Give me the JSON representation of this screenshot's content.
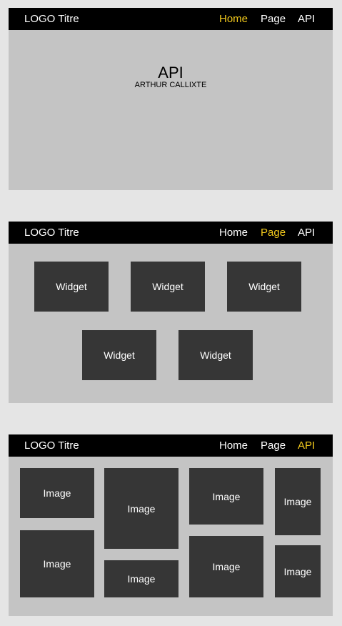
{
  "frames": [
    {
      "nav": {
        "logo": "LOGO Titre",
        "links": [
          "Home",
          "Page",
          "API"
        ],
        "active": "Home"
      },
      "hero": {
        "title": "API",
        "subtitle": "ARTHUR CALLIXTE"
      }
    },
    {
      "nav": {
        "logo": "LOGO Titre",
        "links": [
          "Home",
          "Page",
          "API"
        ],
        "active": "Page"
      },
      "widgets": [
        "Widget",
        "Widget",
        "Widget",
        "Widget",
        "Widget"
      ]
    },
    {
      "nav": {
        "logo": "LOGO Titre",
        "links": [
          "Home",
          "Page",
          "API"
        ],
        "active": "API"
      },
      "images": [
        "Image",
        "Image",
        "Image",
        "Image",
        "Image",
        "Image",
        "Image",
        "Image"
      ]
    }
  ],
  "colors": {
    "accent": "#f2c91c",
    "navbar": "#000000",
    "panel": "#c4c4c4",
    "tile": "#363636",
    "page": "#e5e5e5"
  }
}
